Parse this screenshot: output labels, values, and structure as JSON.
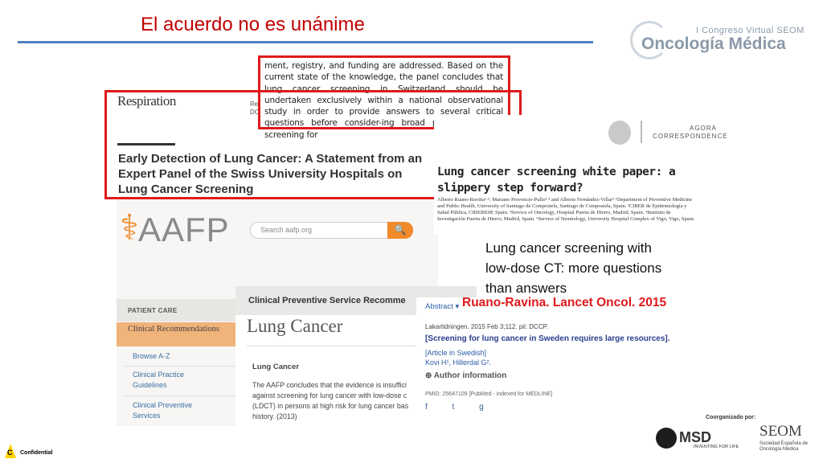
{
  "slide": {
    "title": "El acuerdo no es unánime"
  },
  "congress_logo": {
    "line1": "I Congreso Virtual SEOM",
    "line2": "Oncología Médica"
  },
  "respiration": {
    "journal": "Respiration",
    "meta_line1": "Re",
    "meta_line2": "DC",
    "headline": "Early Detection of Lung Cancer: A Statement from an Expert Panel of the Swiss University Hospitals on Lung Cancer Screening"
  },
  "excerpt": {
    "text": "ment, registry, and funding are addressed. Based on the current state of the knowledge, the panel concludes that lung cancer screening in Switzerland should be undertaken exclusively within a national observational study in order to provide answers to several critical questions before consider-ing broad population-based screening for"
  },
  "aafp": {
    "logo": "AAFP",
    "search_placeholder": "Search aafp.org",
    "patient_care": "PATIENT CARE",
    "clinical_recommendations": "Clinical Recommendations",
    "browse": "Browse A-Z",
    "clinical_practice": "Clinical Practice Guidelines",
    "clinical_preventive": "Clinical Preventive Services",
    "panel_header": "Clinical Preventive Service Recomme",
    "panel_title": "Lung Cancer",
    "panel_subtitle": "Lung Cancer",
    "panel_body": "The AAFP concludes that the evidence is insuffici against screening for lung cancer with low-dose c (LDCT) in persons at high risk for lung cancer bas history. (2013)"
  },
  "agora": {
    "label1": "AGORA",
    "label2": "CORRESPONDENCE",
    "title": "Lung cancer screening white paper: a slippery step forward?",
    "authors": "Alberto Ruano-Ravina¹·², Mariano Provencio-Pulla³·⁴ and Alberto Fernández-Villar⁵ ¹Department of Preventive Medicine and Public Health, University of Santiago de Compostela, Santiago de Compostela, Spain. ²CIBER de Epidemiología y Salud Pública, CIBERESP, Spain. ³Service of Oncology, Hospital Puerta de Hierro, Madrid, Spain. ⁴Instituto de Investigación Puerta de Hierro, Madrid, Spain. ⁵Service of Neumology, University Hospital Complex of Vigo, Vigo, Spain."
  },
  "lancet": {
    "title": "Lung cancer screening with low-dose CT: more questions than answers",
    "citation": "Ruano-Ravina. Lancet Oncol. 2015"
  },
  "pubmed": {
    "abstract_label": "Abstract ▾",
    "journal": "Lakartidningen. 2015 Feb 3;112. pii: DCCP.",
    "title": "[Screening for lung cancer in Sweden requires large resources].",
    "language": "[Article in Swedish]",
    "authors": "Kovi H¹, Hillerdal G².",
    "author_info": "⊕ Author information",
    "pmid": "PMID: 25647109 [PubMed - indexed for MEDLINE]",
    "share": "f t g"
  },
  "footer": {
    "organizer": "Coorganizado por:",
    "msd": "MSD",
    "msd_sub": "INVENTING FOR LIFE",
    "seom": "SEOM",
    "seom_sub": "Sociedad Española de Oncología Médica",
    "confidential": "Confidential",
    "confidential_mark": "C"
  }
}
